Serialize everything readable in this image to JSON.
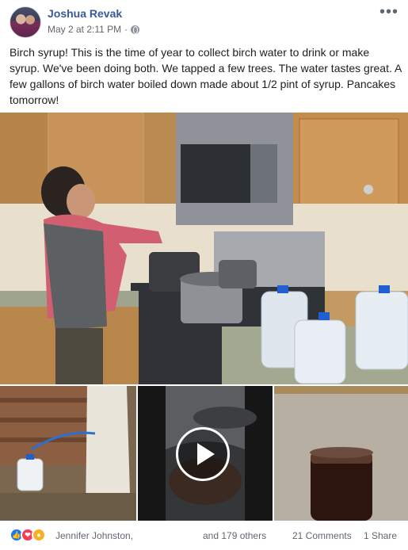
{
  "post": {
    "author": "Joshua Revak",
    "timestamp": "May 2 at 2:11 PM",
    "separator": "·",
    "privacy_icon": "globe-icon",
    "more_label": "•••",
    "text": "Birch syrup! This is the time of year to collect birch water to drink or make syrup. We've been doing both. We tapped a few trees. The water tastes great. A few gallons of birch water boiled down made about 1/2 pint of syrup. Pancakes tomorrow!"
  },
  "media": {
    "main_photo": "woman-cooking-birch-water-photo",
    "thumbnails": [
      "tapped-birch-tree-jug-photo",
      "boiling-pot-video-thumbnail",
      "syrup-jar-photo"
    ],
    "video_play_icon": "play-icon"
  },
  "footer": {
    "reactions": [
      "like-icon",
      "love-icon",
      "wow-icon"
    ],
    "reaction_names": "Jennifer Johnston,",
    "others": "and 179 others",
    "comments": "21 Comments",
    "shares": "1 Share"
  },
  "colors": {
    "author": "#385898",
    "like": "#1877f2",
    "love": "#f33e58",
    "wow": "#f7b125"
  }
}
